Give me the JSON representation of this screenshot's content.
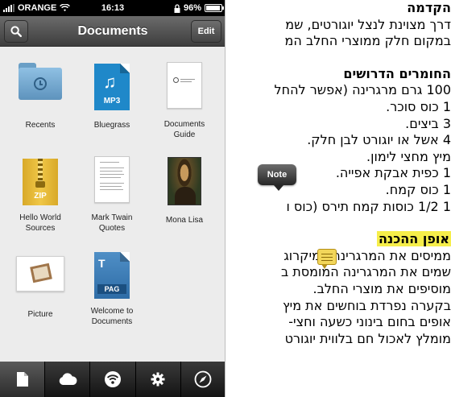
{
  "status_bar": {
    "carrier": "ORANGE",
    "time": "16:13",
    "battery": "96%",
    "battery_level": 0.96,
    "icons": [
      "signal-icon",
      "wifi-icon",
      "lock-icon",
      "battery-icon"
    ]
  },
  "nav_bar": {
    "title": "Documents",
    "edit_label": "Edit",
    "search_icon": "search-icon"
  },
  "files": [
    {
      "label": "Recents",
      "kind": "folder"
    },
    {
      "label": "Bluegrass",
      "kind": "audio",
      "ext": "MP3"
    },
    {
      "label": "Documents Guide",
      "kind": "pdf"
    },
    {
      "label": "Hello World Sources",
      "kind": "archive",
      "ext": "ZIP"
    },
    {
      "label": "Mark Twain Quotes",
      "kind": "text"
    },
    {
      "label": "Mona Lisa",
      "kind": "image"
    },
    {
      "label": "Picture",
      "kind": "image"
    },
    {
      "label": "Welcome to Documents",
      "kind": "pages",
      "ext": "PAG"
    }
  ],
  "tab_bar": {
    "tabs": [
      {
        "icon": "document-icon",
        "active": true
      },
      {
        "icon": "cloud-icon",
        "active": false
      },
      {
        "icon": "wifi-share-icon",
        "active": false
      },
      {
        "icon": "gear-icon",
        "active": false
      },
      {
        "icon": "compass-icon",
        "active": false
      }
    ]
  },
  "article": {
    "intro_heading": "הקדמה",
    "intro_lines": [
      "דרך מצוינת לנצל יוגורטים, שמ",
      "במקום חלק ממוצרי החלב המ"
    ],
    "ingredients_heading": "החומרים הדרושים",
    "ingredients": [
      "100 גרם מרגרינה (אפשר להחל",
      "1 כוס סוכר.",
      "3 ביצים.",
      "4 אשל או יוגורט לבן חלק.",
      "מיץ מחצי לימון.",
      "1 כפית אבקת אפייה.",
      "1 כוס קמח.",
      "1 1/2 כוסות קמח תירס (כוס ו"
    ],
    "method_heading": "אופן ההכנה",
    "method_lines": [
      "ממיסים את המרגרינה במיקרוג",
      "שמים את המרגרינה המומסת ב",
      "מוסיפים את מוצרי החלב.",
      "בקערה נפרדת בוחשים את מיץ",
      "אופים בחום בינוני כשעה וחצי-",
      "מומלץ לאכול חם בלווית יוגורט"
    ],
    "note_label": "Note",
    "note_icon": "note-icon",
    "highlight_color": "#f6ee4a"
  }
}
